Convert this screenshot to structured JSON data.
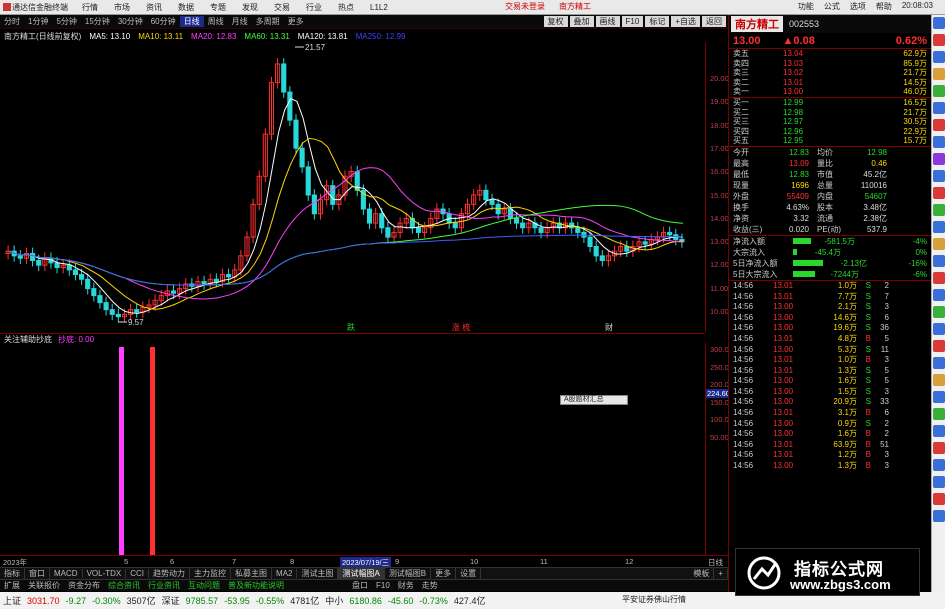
{
  "menubar": {
    "app_name": "通达信金融终端",
    "items": [
      "行情",
      "市场",
      "资讯",
      "数据",
      "专题",
      "发现",
      "交易",
      "行业",
      "热点",
      "L1L2"
    ],
    "center_links": [
      "交易未登录",
      "南方精工"
    ],
    "right_items": [
      "功能",
      "公式",
      "选项",
      "帮助",
      "20:08:03"
    ]
  },
  "periodbar": {
    "periods": [
      "分时",
      "1分钟",
      "5分钟",
      "15分钟",
      "30分钟",
      "60分钟",
      "日线",
      "周线",
      "月线",
      "多周期",
      "更多"
    ],
    "active": "日线",
    "right_tools": [
      "复权",
      "叠加",
      "画线",
      "F10",
      "标记",
      "+自选",
      "返回"
    ]
  },
  "chart_header": {
    "title": "南方精工(日线前复权)",
    "ma": [
      {
        "label": "MA5: 13.10",
        "color": "#ffffff"
      },
      {
        "label": "MA10: 13.11",
        "color": "#ffd700"
      },
      {
        "label": "MA20: 12.83",
        "color": "#ff40ff"
      },
      {
        "label": "MA60: 13.31",
        "color": "#40ff40"
      },
      {
        "label": "MA120: 13.81",
        "color": "#ffffff"
      },
      {
        "label": "MA250: 12.99",
        "color": "#4040ff"
      }
    ]
  },
  "annotations": {
    "high": "21.57",
    "low": "9.57",
    "marks": [
      "跌",
      "涨 梳",
      "财"
    ]
  },
  "yaxis_main": [
    "20.00",
    "19.00",
    "18.00",
    "17.00",
    "16.00",
    "15.00",
    "14.00",
    "13.00",
    "12.00",
    "11.00",
    "10.00"
  ],
  "sub_header": {
    "name": "关注辅助抄底",
    "value": "抄底: 0.00"
  },
  "yaxis_sub": [
    "300.00",
    "250.00",
    "200.00",
    "150.00",
    "100.00",
    "50.00"
  ],
  "yaxis_sub_highlight": "224.60",
  "popup_label": "A股题材汇总",
  "timeaxis": {
    "left_label": "2023年",
    "ticks": [
      "5",
      "6",
      "7",
      "8",
      "9",
      "10",
      "11",
      "12"
    ],
    "selected": "2023/07/19/三",
    "right_label": "日线"
  },
  "indicator_tabs": [
    "指标",
    "窗口",
    "MACD",
    "VOL-TDX",
    "CCI",
    "趋势动力",
    "主力监控",
    "私募主图",
    "MA2",
    "测试主图",
    "测试幅图A",
    "测试幅图B",
    "更多",
    "设置"
  ],
  "indicator_active": "测试幅图A",
  "right_tabs": [
    "模板",
    "+"
  ],
  "ext_bar": [
    "扩展",
    "关联报价",
    "资金分布",
    "综合资讯",
    "行业资讯",
    "互动问题",
    "普及新功能说明"
  ],
  "ext_bar_right": [
    "盘口",
    "F10",
    "财务",
    "走势"
  ],
  "status": {
    "sh": {
      "name": "上证",
      "value": "3031.70",
      "chg": "-9.27",
      "pct": "-0.30%",
      "amt": "3507亿"
    },
    "sz": {
      "name": "深证",
      "value": "9785.57",
      "chg": "-53.95",
      "pct": "-0.55%",
      "amt": "4781亿"
    },
    "zx": {
      "name": "中小",
      "value": "6180.86",
      "chg": "-45.60",
      "pct": "-0.73%",
      "amt": "427.4亿"
    },
    "broker": "平安证券佛山行情"
  },
  "stock": {
    "name": "南方精工",
    "code": "002553",
    "price": "13.00",
    "change": "▲0.08",
    "pct": "0.62%"
  },
  "orderbook": {
    "sell": [
      {
        "label": "卖五",
        "price": "13.04",
        "vol": "62.9万"
      },
      {
        "label": "卖四",
        "price": "13.03",
        "vol": "85.9万"
      },
      {
        "label": "卖三",
        "price": "13.02",
        "vol": "21.7万"
      },
      {
        "label": "卖二",
        "price": "13.01",
        "vol": "14.5万"
      },
      {
        "label": "卖一",
        "price": "13.00",
        "vol": "46.0万"
      }
    ],
    "buy": [
      {
        "label": "买一",
        "price": "12.99",
        "vol": "16.5万"
      },
      {
        "label": "买二",
        "price": "12.98",
        "vol": "21.7万"
      },
      {
        "label": "买三",
        "price": "12.97",
        "vol": "30.5万"
      },
      {
        "label": "买四",
        "price": "12.96",
        "vol": "22.9万"
      },
      {
        "label": "买五",
        "price": "12.95",
        "vol": "15.7万"
      }
    ]
  },
  "quotes": [
    {
      "a": "今开",
      "b": "12.83",
      "bc": "green",
      "c": "均价",
      "d": "12.98",
      "dc": "green"
    },
    {
      "a": "最高",
      "b": "13.09",
      "bc": "red",
      "c": "量比",
      "d": "0.46",
      "dc": "yel"
    },
    {
      "a": "最低",
      "b": "12.83",
      "bc": "green",
      "c": "市值",
      "d": "45.2亿",
      "dc": "wht"
    },
    {
      "a": "现量",
      "b": "1696",
      "bc": "yel",
      "c": "总量",
      "d": "110016",
      "dc": "wht"
    },
    {
      "a": "外盘",
      "b": "55409",
      "bc": "red",
      "c": "内盘",
      "d": "54607",
      "dc": "green"
    },
    {
      "a": "换手",
      "b": "4.63%",
      "bc": "wht",
      "c": "股本",
      "d": "3.48亿",
      "dc": "wht"
    },
    {
      "a": "净资",
      "b": "3.32",
      "bc": "wht",
      "c": "流通",
      "d": "2.38亿",
      "dc": "wht"
    },
    {
      "a": "收益(三)",
      "b": "0.020",
      "bc": "wht",
      "c": "PE(动)",
      "d": "537.9",
      "dc": "wht"
    }
  ],
  "flows": [
    {
      "a": "净流入额",
      "v": "-581.5万",
      "p": "-4%"
    },
    {
      "a": "大宗流入",
      "v": "-45.4万",
      "p": "0%"
    },
    {
      "a": "5日净流入额",
      "v": "-2.13亿",
      "p": "-16%"
    },
    {
      "a": "5日大宗流入",
      "v": "-7244万",
      "p": "-6%"
    }
  ],
  "trades": [
    {
      "t": "14:56",
      "p": "13.01",
      "v": "1.0万",
      "s": "S",
      "n": "2"
    },
    {
      "t": "14:56",
      "p": "13.01",
      "v": "7.7万",
      "s": "S",
      "n": "7"
    },
    {
      "t": "14:56",
      "p": "13.00",
      "v": "2.1万",
      "s": "S",
      "n": "3"
    },
    {
      "t": "14:56",
      "p": "13.00",
      "v": "14.6万",
      "s": "S",
      "n": "6"
    },
    {
      "t": "14:56",
      "p": "13.00",
      "v": "19.6万",
      "s": "S",
      "n": "36"
    },
    {
      "t": "14:56",
      "p": "13.01",
      "v": "4.8万",
      "s": "B",
      "n": "5"
    },
    {
      "t": "14:56",
      "p": "13.00",
      "v": "5.3万",
      "s": "S",
      "n": "11"
    },
    {
      "t": "14:56",
      "p": "13.01",
      "v": "1.0万",
      "s": "B",
      "n": "3"
    },
    {
      "t": "14:56",
      "p": "13.01",
      "v": "1.3万",
      "s": "S",
      "n": "5"
    },
    {
      "t": "14:56",
      "p": "13.00",
      "v": "1.6万",
      "s": "S",
      "n": "5"
    },
    {
      "t": "14:56",
      "p": "13.00",
      "v": "1.5万",
      "s": "S",
      "n": "3"
    },
    {
      "t": "14:56",
      "p": "13.00",
      "v": "20.9万",
      "s": "S",
      "n": "33"
    },
    {
      "t": "14:56",
      "p": "13.01",
      "v": "3.1万",
      "s": "B",
      "n": "6"
    },
    {
      "t": "14:56",
      "p": "13.00",
      "v": "0.9万",
      "s": "S",
      "n": "2"
    },
    {
      "t": "14:56",
      "p": "13.00",
      "v": "1.6万",
      "s": "B",
      "n": "2"
    },
    {
      "t": "14:56",
      "p": "13.01",
      "v": "63.9万",
      "s": "B",
      "n": "51"
    },
    {
      "t": "14:56",
      "p": "13.01",
      "v": "1.2万",
      "s": "B",
      "n": "3"
    },
    {
      "t": "14:56",
      "p": "13.00",
      "v": "1.3万",
      "s": "B",
      "n": "3"
    }
  ],
  "watermark": {
    "title": "指标公式网",
    "url": "www.zbgs3.com"
  },
  "colors": {
    "up": "#ff3030",
    "down": "#29d829",
    "grid": "#7a0000",
    "accent": "#1b2a8c"
  }
}
